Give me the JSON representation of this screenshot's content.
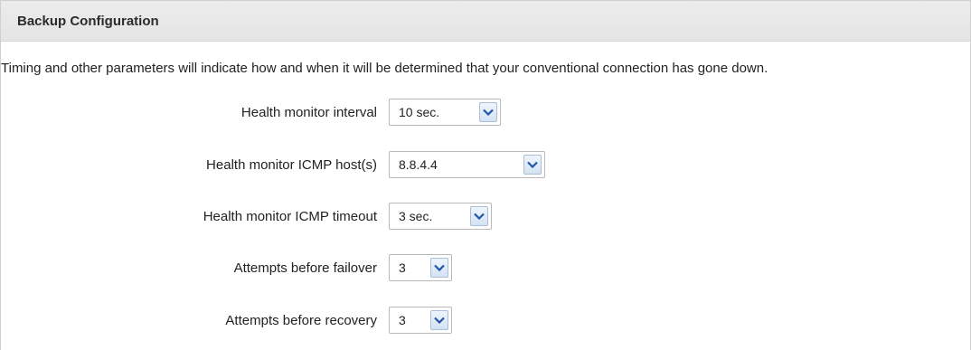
{
  "panel": {
    "title": "Backup Configuration",
    "description": "Timing and other parameters will indicate how and when it will be determined that your conventional connection has gone down."
  },
  "fields": [
    {
      "label": "Health monitor interval",
      "value": "10 sec."
    },
    {
      "label": "Health monitor ICMP host(s)",
      "value": "8.8.4.4"
    },
    {
      "label": "Health monitor ICMP timeout",
      "value": "3 sec."
    },
    {
      "label": "Attempts before failover",
      "value": "3"
    },
    {
      "label": "Attempts before recovery",
      "value": "3"
    }
  ],
  "icons": {
    "dropdown": "chevron-down-icon"
  },
  "colors": {
    "header_bg": "#e8e8e8",
    "arrow_button_bg": "#dbe6f4",
    "arrow_color": "#1f56a8"
  }
}
